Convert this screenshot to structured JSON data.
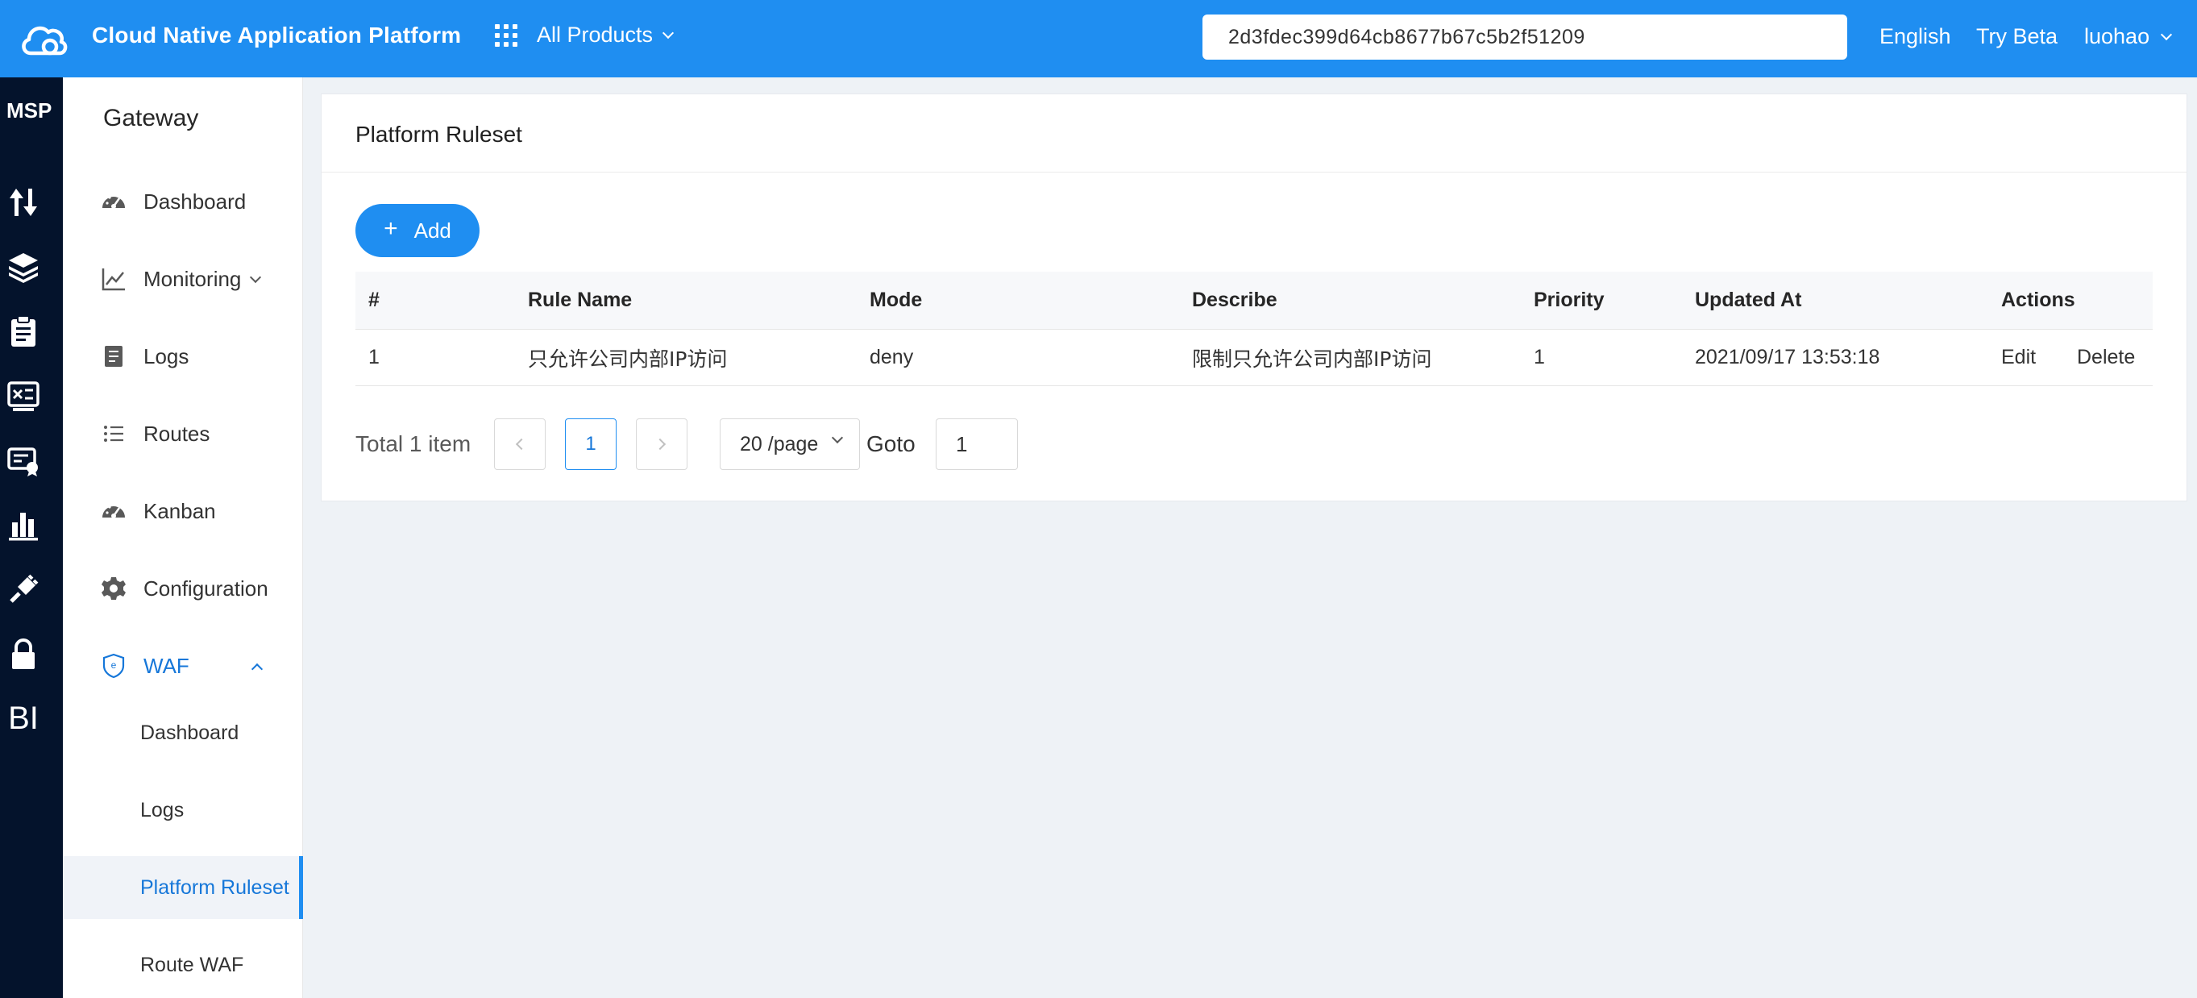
{
  "header": {
    "app_title": "Cloud Native Application Platform",
    "products_label": "All Products",
    "search_value": "2d3fdec399d64cb8677b67c5b2f51209",
    "language": "English",
    "try_beta": "Try Beta",
    "user": "luohao"
  },
  "rail": {
    "title": "MSP",
    "bi_label": "BI",
    "icons": [
      "transfer-icon",
      "layers-icon",
      "clipboard-icon",
      "monitor-icon",
      "certificate-icon",
      "bar-chart-icon",
      "plug-icon",
      "lock-icon",
      "bi-icon"
    ]
  },
  "sidebar": {
    "title": "Gateway",
    "items": [
      {
        "label": "Dashboard",
        "icon": "dashboard-icon"
      },
      {
        "label": "Monitoring",
        "icon": "line-chart-icon"
      },
      {
        "label": "Logs",
        "icon": "file-text-icon"
      },
      {
        "label": "Routes",
        "icon": "list-icon"
      },
      {
        "label": "Kanban",
        "icon": "dashboard-icon"
      },
      {
        "label": "Configuration",
        "icon": "gear-icon"
      },
      {
        "label": "WAF",
        "icon": "shield-icon"
      }
    ],
    "waf_children": [
      {
        "label": "Dashboard"
      },
      {
        "label": "Logs"
      },
      {
        "label": "Platform Ruleset",
        "active": true
      },
      {
        "label": "Route WAF"
      }
    ]
  },
  "main": {
    "title": "Platform Ruleset",
    "add_label": "Add",
    "table": {
      "columns": [
        "#",
        "Rule Name",
        "Mode",
        "Describe",
        "Priority",
        "Updated At",
        "Actions"
      ],
      "rows": [
        {
          "index": "1",
          "rule_name": "只允许公司内部IP访问",
          "mode": "deny",
          "describe": "限制只允许公司内部IP访问",
          "priority": "1",
          "updated_at": "2021/09/17 13:53:18",
          "edit": "Edit",
          "delete": "Delete"
        }
      ]
    },
    "pagination": {
      "total": "Total 1 item",
      "current_page": "1",
      "page_size": "20 /page",
      "goto_label": "Goto",
      "goto_value": "1"
    }
  },
  "colors": {
    "primary": "#1f8ef1",
    "rail_bg": "#04132c",
    "page_bg": "#eef2f6",
    "link": "#1677d9"
  }
}
